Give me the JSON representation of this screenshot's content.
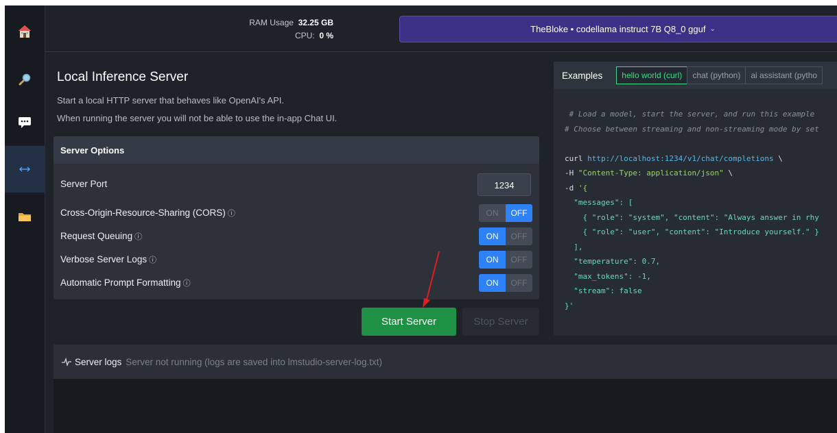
{
  "sidebar": {
    "items": [
      {
        "name": "home"
      },
      {
        "name": "search"
      },
      {
        "name": "chat"
      },
      {
        "name": "server"
      },
      {
        "name": "models-folder"
      }
    ]
  },
  "topbar": {
    "ram_label": "RAM Usage",
    "ram_value": "32.25 GB",
    "cpu_label": "CPU:",
    "cpu_value": "0 %",
    "model_selected": "TheBloke • codellama instruct 7B Q8_0 gguf"
  },
  "main": {
    "title": "Local Inference Server",
    "description_1": "Start a local HTTP server that behaves like OpenAI's API.",
    "description_2": "When running the server you will not be able to use the in-app Chat UI."
  },
  "server_options": {
    "heading": "Server Options",
    "port_label": "Server Port",
    "port_value": "1234",
    "on_label": "ON",
    "off_label": "OFF",
    "toggles": [
      {
        "label": "Cross-Origin-Resource-Sharing (CORS)",
        "value": "OFF"
      },
      {
        "label": "Request Queuing",
        "value": "ON"
      },
      {
        "label": "Verbose Server Logs",
        "value": "ON"
      },
      {
        "label": "Automatic Prompt Formatting",
        "value": "ON"
      }
    ]
  },
  "actions": {
    "start_label": "Start Server",
    "stop_label": "Stop Server"
  },
  "logs": {
    "label": "Server logs",
    "status": "Server not running (logs are saved into lmstudio-server-log.txt)"
  },
  "examples": {
    "label": "Examples",
    "tabs": [
      "hello world (curl)",
      "chat (python)",
      "ai assistant (pytho"
    ],
    "code": {
      "comment_1": " # Load a model, start the server, and run this example ",
      "comment_2": "# Choose between streaming and non-streaming mode by set",
      "curl_cmd": "curl ",
      "curl_url": "http://localhost:1234/v1/chat/completions",
      "curl_tail": " \\",
      "h_flag": "-H ",
      "h_value": "\"Content-Type: application/json\"",
      "h_tail": " \\",
      "d_flag": "-d ",
      "d_open": "'{",
      "messages_key": "  \"messages\"",
      "messages_open": ": [",
      "msg_1": "    { \"role\": \"system\", \"content\": \"Always answer in rhy",
      "msg_2": "    { \"role\": \"user\", \"content\": \"Introduce yourself.\" }",
      "messages_close": "  ],",
      "temperature_key": "  \"temperature\"",
      "temperature_val": ": 0.7,",
      "max_tokens_key": "  \"max_tokens\"",
      "max_tokens_val": ": -1,",
      "stream_key": "  \"stream\"",
      "stream_val": ": false",
      "close": "}'"
    }
  },
  "colors": {
    "accent_blue": "#2f81f7",
    "start_green": "#1f9145",
    "model_purple": "#3b3287",
    "tab_active_green": "#3ddc84"
  }
}
